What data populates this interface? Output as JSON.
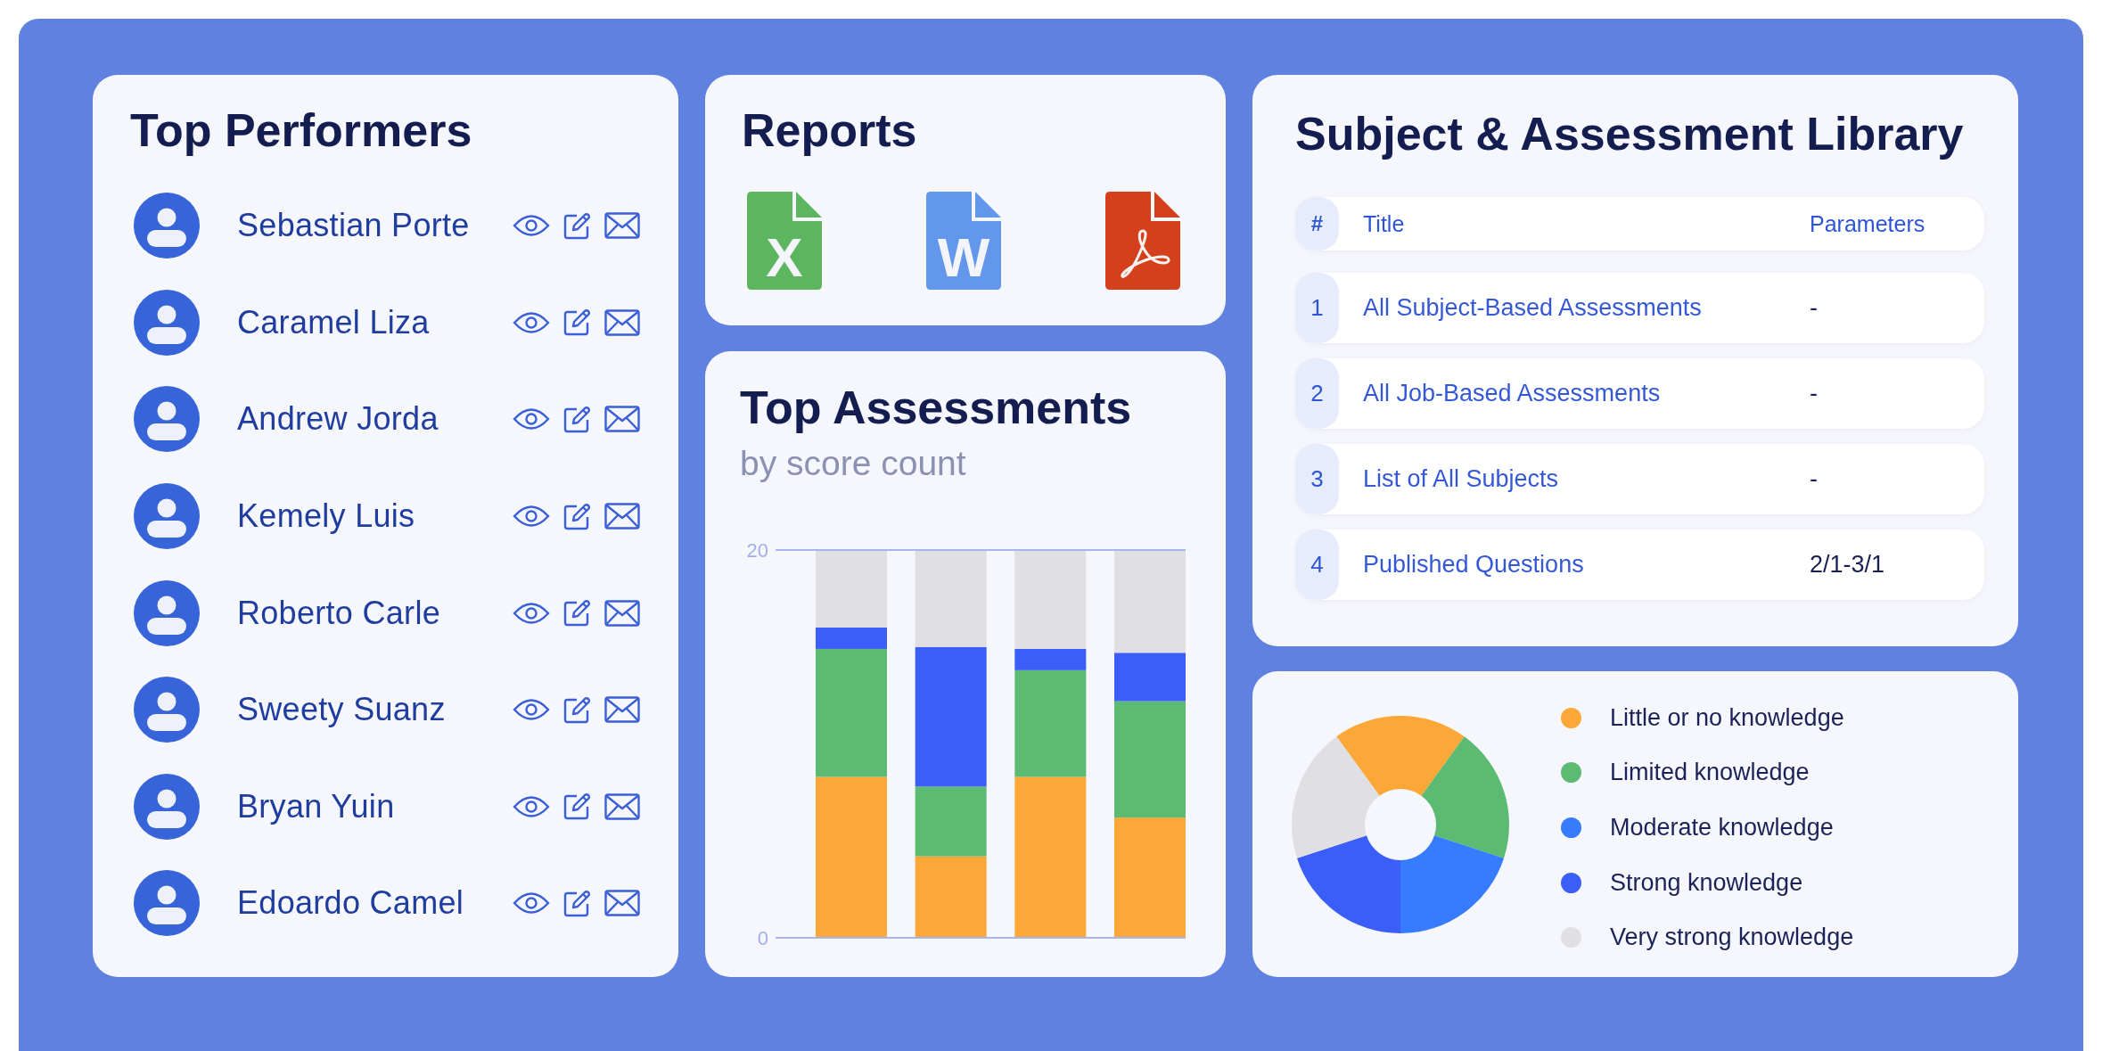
{
  "top_performers": {
    "title": "Top Performers",
    "people": [
      {
        "name": "Sebastian Porte"
      },
      {
        "name": "Caramel Liza"
      },
      {
        "name": "Andrew Jorda"
      },
      {
        "name": "Kemely Luis"
      },
      {
        "name": "Roberto Carle"
      },
      {
        "name": "Sweety Suanz"
      },
      {
        "name": "Bryan Yuin"
      },
      {
        "name": "Edoardo Camel"
      }
    ]
  },
  "reports": {
    "title": "Reports",
    "files": [
      {
        "kind": "spreadsheet",
        "letter": "X"
      },
      {
        "kind": "document",
        "letter": "W"
      },
      {
        "kind": "pdf"
      }
    ]
  },
  "top_assessments": {
    "title": "Top Assessments",
    "subtitle": "by score count",
    "chart_data": {
      "type": "bar",
      "stacked": true,
      "ylim": [
        0,
        20
      ],
      "yticks": [
        0,
        20
      ],
      "series": [
        {
          "color": "#fba838",
          "values": [
            8.3,
            4.2,
            8.3,
            6.2
          ]
        },
        {
          "color": "#5bbb73",
          "values": [
            6.6,
            3.6,
            5.5,
            6.0
          ]
        },
        {
          "color": "#3b5ef8",
          "values": [
            1.1,
            7.2,
            1.1,
            2.5
          ]
        },
        {
          "color": "#dfdfe4",
          "values": [
            4.0,
            5.0,
            5.1,
            5.3
          ]
        }
      ]
    }
  },
  "library": {
    "title": "Subject & Assessment Library",
    "columns": [
      "#",
      "Title",
      "Parameters"
    ],
    "rows": [
      {
        "number": "1",
        "title": "All Subject-Based Assessments",
        "parameters": "-"
      },
      {
        "number": "2",
        "title": "All Job-Based Assessments",
        "parameters": "-"
      },
      {
        "number": "3",
        "title": "List of All Subjects",
        "parameters": "-"
      },
      {
        "number": "4",
        "title": "Published Questions",
        "parameters": "2/1-3/1"
      }
    ]
  },
  "knowledge_levels": {
    "legend": [
      {
        "label": "Little or no knowledge",
        "color": "#fba838"
      },
      {
        "label": "Limited knowledge",
        "color": "#5bbb73"
      },
      {
        "label": "Moderate knowledge",
        "color": "#377bff"
      },
      {
        "label": "Strong knowledge",
        "color": "#3b5ef8"
      },
      {
        "label": "Very strong knowledge",
        "color": "#dfdfe4"
      }
    ]
  }
}
